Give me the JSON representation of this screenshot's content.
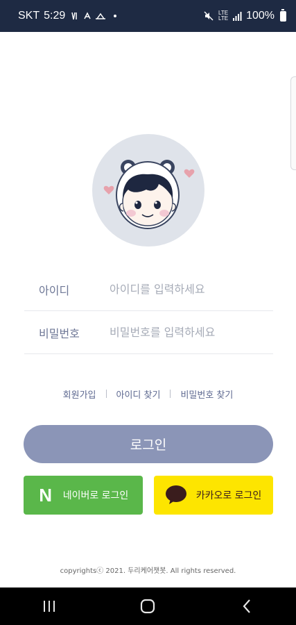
{
  "status_bar": {
    "carrier": "SKT",
    "time": "5:29",
    "network_top": "LTE",
    "network_bottom": "LTE",
    "battery": "100%"
  },
  "login_form": {
    "id_label": "아이디",
    "id_placeholder": "아이디를 입력하세요",
    "password_label": "비밀번호",
    "password_placeholder": "비밀번호를 입력하세요"
  },
  "links": {
    "signup": "회원가입",
    "find_id": "아이디 찾기",
    "find_password": "비밀번호 찾기"
  },
  "buttons": {
    "login": "로그인",
    "naver_logo": "N",
    "naver_login": "네이버로 로그인",
    "kakao_login": "카카오로 로그인"
  },
  "colors": {
    "status_bar": "#1e2a43",
    "login_button": "#8b95b7",
    "naver": "#5ab74a",
    "kakao": "#fde500",
    "label": "#6e7796"
  },
  "footer": {
    "copyright": "copyrightsⓒ 2021. 두리케어챗봇. All rights reserved."
  }
}
